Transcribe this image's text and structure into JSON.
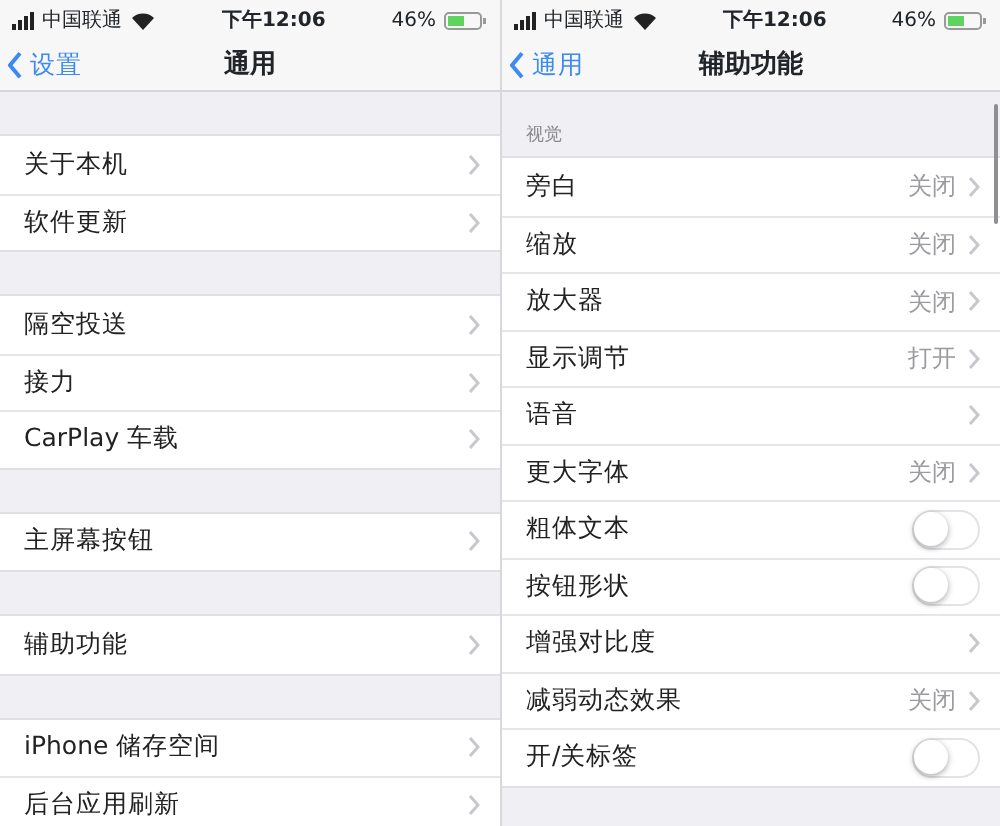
{
  "screens": [
    {
      "status_bar": {
        "carrier": "中国联通",
        "time": "下午12:06",
        "battery": "46%"
      },
      "nav": {
        "back": "设置",
        "title": "通用"
      },
      "groups": [
        {
          "rows": [
            {
              "label": "关于本机",
              "kind": "link"
            },
            {
              "label": "软件更新",
              "kind": "link"
            }
          ]
        },
        {
          "rows": [
            {
              "label": "隔空投送",
              "kind": "link"
            },
            {
              "label": "接力",
              "kind": "link"
            },
            {
              "label": "CarPlay 车载",
              "kind": "link"
            }
          ]
        },
        {
          "rows": [
            {
              "label": "主屏幕按钮",
              "kind": "link"
            }
          ]
        },
        {
          "rows": [
            {
              "label": "辅助功能",
              "kind": "link"
            }
          ]
        },
        {
          "rows": [
            {
              "label": "iPhone 储存空间",
              "kind": "link"
            },
            {
              "label": "后台应用刷新",
              "kind": "link"
            }
          ]
        }
      ]
    },
    {
      "status_bar": {
        "carrier": "中国联通",
        "time": "下午12:06",
        "battery": "46%"
      },
      "nav": {
        "back": "通用",
        "title": "辅助功能"
      },
      "groups": [
        {
          "header": "视觉",
          "rows": [
            {
              "label": "旁白",
              "kind": "link",
              "value": "关闭"
            },
            {
              "label": "缩放",
              "kind": "link",
              "value": "关闭"
            },
            {
              "label": "放大器",
              "kind": "link",
              "value": "关闭"
            },
            {
              "label": "显示调节",
              "kind": "link",
              "value": "打开"
            },
            {
              "label": "语音",
              "kind": "link"
            },
            {
              "label": "更大字体",
              "kind": "link",
              "value": "关闭"
            },
            {
              "label": "粗体文本",
              "kind": "toggle",
              "on": false
            },
            {
              "label": "按钮形状",
              "kind": "toggle",
              "on": false
            },
            {
              "label": "增强对比度",
              "kind": "link"
            },
            {
              "label": "减弱动态效果",
              "kind": "link",
              "value": "关闭"
            },
            {
              "label": "开/关标签",
              "kind": "toggle",
              "on": false
            }
          ]
        }
      ]
    }
  ]
}
